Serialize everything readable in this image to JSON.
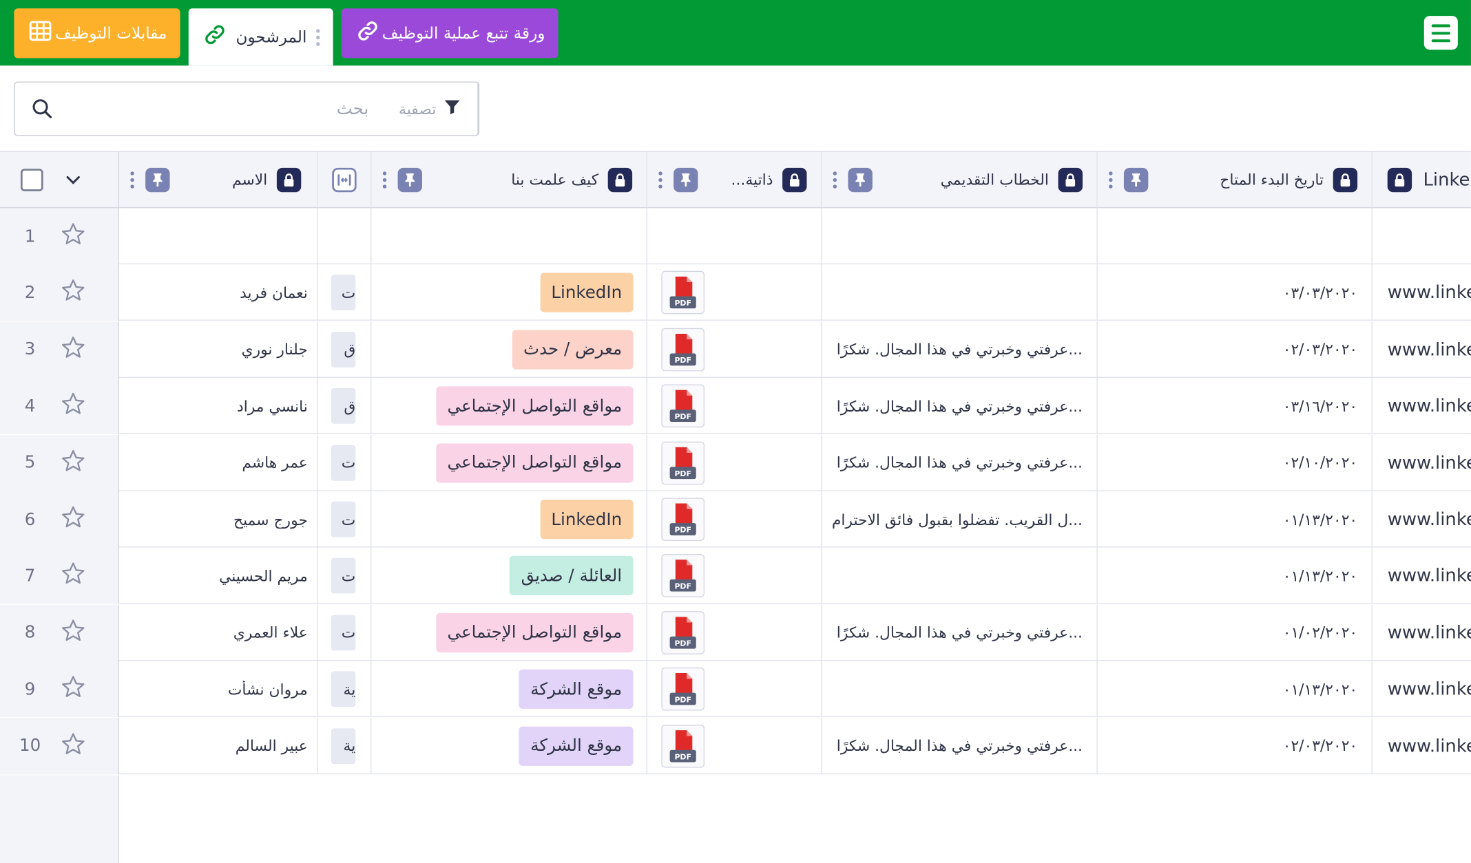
{
  "tabs": {
    "interviews": "مقابلات التوظيف",
    "candidates": "المرشحون",
    "tracking": "ورقة تتبع عملية التوظيف"
  },
  "toolbar": {
    "filter_label": "تصفية",
    "search_placeholder": "بحث"
  },
  "colors": {
    "topbar": "#029a35",
    "tab_interviews": "#fdb12b",
    "tab_tracking": "#9b49d8",
    "lock": "#242a58",
    "pin": "#7a82b4",
    "pdf_red": "#e02a2a"
  },
  "columns": {
    "name": "الاسم",
    "how": "كيف علمت بنا",
    "cv": "...ذاتية",
    "cover": "الخطاب التقديمي",
    "date": "تاريخ البدء المتاح",
    "link": "Linke"
  },
  "rows": [
    {
      "num": "1",
      "name": "",
      "exp": "",
      "how": "",
      "cv": false,
      "cover": "",
      "date": "",
      "link": ""
    },
    {
      "num": "2",
      "name": "نعمان فريد",
      "exp": "ت",
      "how": "LinkedIn",
      "how_color": "#fdd1a6",
      "cv": true,
      "cover": "",
      "date": "٠٣/٠٣/٢٠٢٠",
      "link": "www.linke"
    },
    {
      "num": "3",
      "name": "جلنار نوري",
      "exp": "ق",
      "how": "معرض / حدث",
      "how_color": "#fdd3c9",
      "cv": true,
      "cover": "...عرفتي وخبرتي في هذا المجال. شكرًا",
      "date": "٠٢/٠٣/٢٠٢٠",
      "link": "www.linke"
    },
    {
      "num": "4",
      "name": "نانسي مراد",
      "exp": "ق",
      "how": "مواقع التواصل الإجتماعي",
      "how_color": "#fbd3e6",
      "cv": true,
      "cover": "...عرفتي وخبرتي في هذا المجال. شكرًا",
      "date": "٠٣/١٦/٢٠٢٠",
      "link": "www.linke"
    },
    {
      "num": "5",
      "name": "عمر هاشم",
      "exp": "ت",
      "how": "مواقع التواصل الإجتماعي",
      "how_color": "#fbd3e6",
      "cv": true,
      "cover": "...عرفتي وخبرتي في هذا المجال. شكرًا",
      "date": "٠٢/١٠/٢٠٢٠",
      "link": "www.linke"
    },
    {
      "num": "6",
      "name": "جورج سميح",
      "exp": "ت",
      "how": "LinkedIn",
      "how_color": "#fdd1a6",
      "cv": true,
      "cover": "...ل القريب. تفضلوا بقبول فائق الاحترام",
      "date": "٠١/١٣/٢٠٢٠",
      "link": "www.linke"
    },
    {
      "num": "7",
      "name": "مريم الحسيني",
      "exp": "ت",
      "how": "العائلة / صديق",
      "how_color": "#c5eee2",
      "cv": true,
      "cover": "",
      "date": "٠١/١٣/٢٠٢٠",
      "link": "www.linke"
    },
    {
      "num": "8",
      "name": "علاء العمري",
      "exp": "ت",
      "how": "مواقع التواصل الإجتماعي",
      "how_color": "#fbd3e6",
      "cv": true,
      "cover": "...عرفتي وخبرتي في هذا المجال. شكرًا",
      "date": "٠١/٠٢/٢٠٢٠",
      "link": "www.linke"
    },
    {
      "num": "9",
      "name": "مروان نشأت",
      "exp": "ية",
      "how": "موقع الشركة",
      "how_color": "#e2d4f8",
      "cv": true,
      "cover": "",
      "date": "٠١/١٣/٢٠٢٠",
      "link": "www.linke"
    },
    {
      "num": "10",
      "name": "عبير السالم",
      "exp": "ية",
      "how": "موقع الشركة",
      "how_color": "#e2d4f8",
      "cv": true,
      "cover": "...عرفتي وخبرتي في هذا المجال. شكرًا",
      "date": "٠٢/٠٣/٢٠٢٠",
      "link": "www.linke"
    }
  ]
}
